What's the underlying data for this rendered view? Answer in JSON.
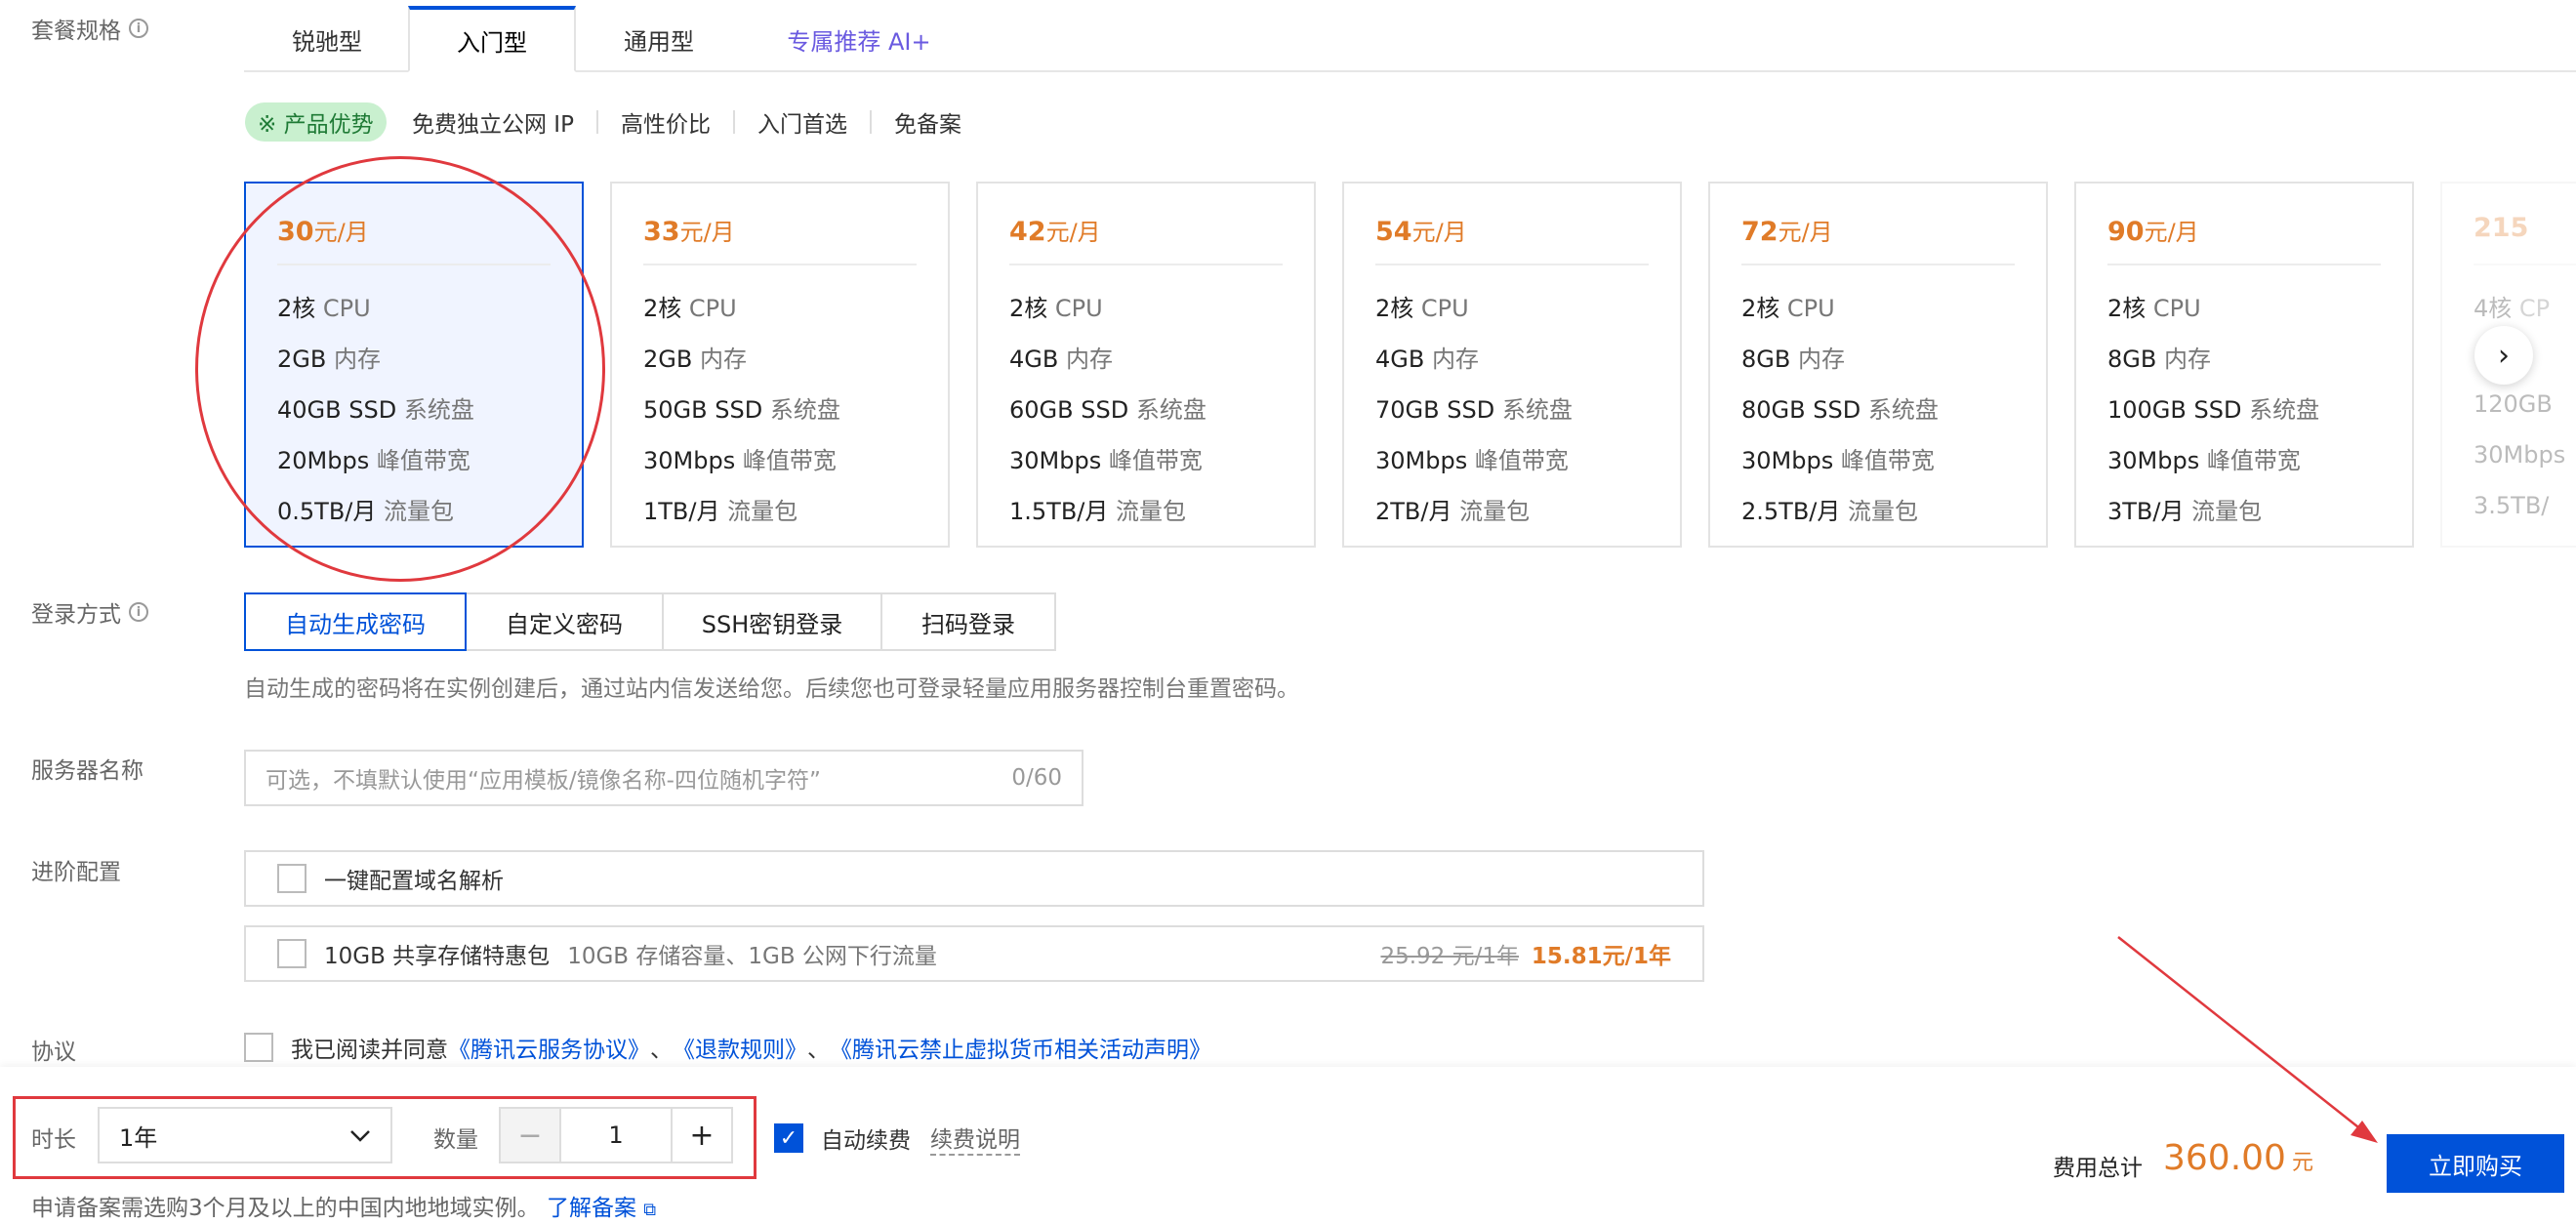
{
  "spec": {
    "label": "套餐规格",
    "tabs": [
      {
        "label": "锐驰型"
      },
      {
        "label": "入门型"
      },
      {
        "label": "通用型"
      },
      {
        "label": "专属推荐 AI+"
      }
    ],
    "feature_badge": "※ 产品优势",
    "features": [
      "免费独立公网 IP",
      "高性价比",
      "入门首选",
      "免备案"
    ],
    "cards": [
      {
        "price": "30",
        "unit": "元/月",
        "cpu": "2核",
        "cpu_l": "CPU",
        "mem": "2GB",
        "mem_l": "内存",
        "disk": "40GB SSD",
        "disk_l": "系统盘",
        "bw": "20Mbps",
        "bw_l": "峰值带宽",
        "traffic": "0.5TB/月",
        "traffic_l": "流量包"
      },
      {
        "price": "33",
        "unit": "元/月",
        "cpu": "2核",
        "cpu_l": "CPU",
        "mem": "2GB",
        "mem_l": "内存",
        "disk": "50GB SSD",
        "disk_l": "系统盘",
        "bw": "30Mbps",
        "bw_l": "峰值带宽",
        "traffic": "1TB/月",
        "traffic_l": "流量包"
      },
      {
        "price": "42",
        "unit": "元/月",
        "cpu": "2核",
        "cpu_l": "CPU",
        "mem": "4GB",
        "mem_l": "内存",
        "disk": "60GB SSD",
        "disk_l": "系统盘",
        "bw": "30Mbps",
        "bw_l": "峰值带宽",
        "traffic": "1.5TB/月",
        "traffic_l": "流量包"
      },
      {
        "price": "54",
        "unit": "元/月",
        "cpu": "2核",
        "cpu_l": "CPU",
        "mem": "4GB",
        "mem_l": "内存",
        "disk": "70GB SSD",
        "disk_l": "系统盘",
        "bw": "30Mbps",
        "bw_l": "峰值带宽",
        "traffic": "2TB/月",
        "traffic_l": "流量包"
      },
      {
        "price": "72",
        "unit": "元/月",
        "cpu": "2核",
        "cpu_l": "CPU",
        "mem": "8GB",
        "mem_l": "内存",
        "disk": "80GB SSD",
        "disk_l": "系统盘",
        "bw": "30Mbps",
        "bw_l": "峰值带宽",
        "traffic": "2.5TB/月",
        "traffic_l": "流量包"
      },
      {
        "price": "90",
        "unit": "元/月",
        "cpu": "2核",
        "cpu_l": "CPU",
        "mem": "8GB",
        "mem_l": "内存",
        "disk": "100GB SSD",
        "disk_l": "系统盘",
        "bw": "30Mbps",
        "bw_l": "峰值带宽",
        "traffic": "3TB/月",
        "traffic_l": "流量包"
      },
      {
        "price": "215",
        "unit": "",
        "cpu": "4核",
        "cpu_l": "CP",
        "mem": "",
        "mem_l": "",
        "disk": "120GB",
        "disk_l": "",
        "bw": "30Mbps",
        "bw_l": "",
        "traffic": "3.5TB/",
        "traffic_l": ""
      }
    ]
  },
  "login": {
    "label": "登录方式",
    "options": [
      "自动生成密码",
      "自定义密码",
      "SSH密钥登录",
      "扫码登录"
    ],
    "hint": "自动生成的密码将在实例创建后，通过站内信发送给您。后续您也可登录轻量应用服务器控制台重置密码。"
  },
  "server_name": {
    "label": "服务器名称",
    "placeholder": "可选，不填默认使用“应用模板/镜像名称-四位随机字符”",
    "counter": "0/60"
  },
  "advanced": {
    "label": "进阶配置",
    "domain_option": "一键配置域名解析",
    "storage_option": "10GB 共享存储特惠包",
    "storage_desc": "10GB 存储容量、1GB 公网下行流量",
    "storage_old_price": "25.92 元/1年",
    "storage_new_price": "15.81元/1年"
  },
  "agreement": {
    "label": "协议",
    "prefix": "我已阅读并同意",
    "link1": "《腾讯云服务协议》",
    "sep1": "、",
    "link2": "《退款规则》",
    "sep2": "、",
    "link3": "《腾讯云禁止虚拟货币相关活动声明》"
  },
  "bottom": {
    "duration_label": "时长",
    "duration_value": "1年",
    "quantity_label": "数量",
    "quantity_value": "1",
    "minus": "−",
    "plus": "+",
    "auto_renew_label": "自动续费",
    "auto_renew_checked": true,
    "renew_link": "续费说明",
    "filing_text": "申请备案需选购3个月及以上的中国内地地域实例。",
    "filing_link": "了解备案",
    "total_label": "费用总计",
    "total_amount": "360.00",
    "total_currency": "元",
    "buy_label": "立即购买"
  },
  "colors": {
    "accent": "#0052d9",
    "price": "#e07b28",
    "annotation_red": "#e0393e",
    "badge_bg": "#c9f0cf"
  }
}
